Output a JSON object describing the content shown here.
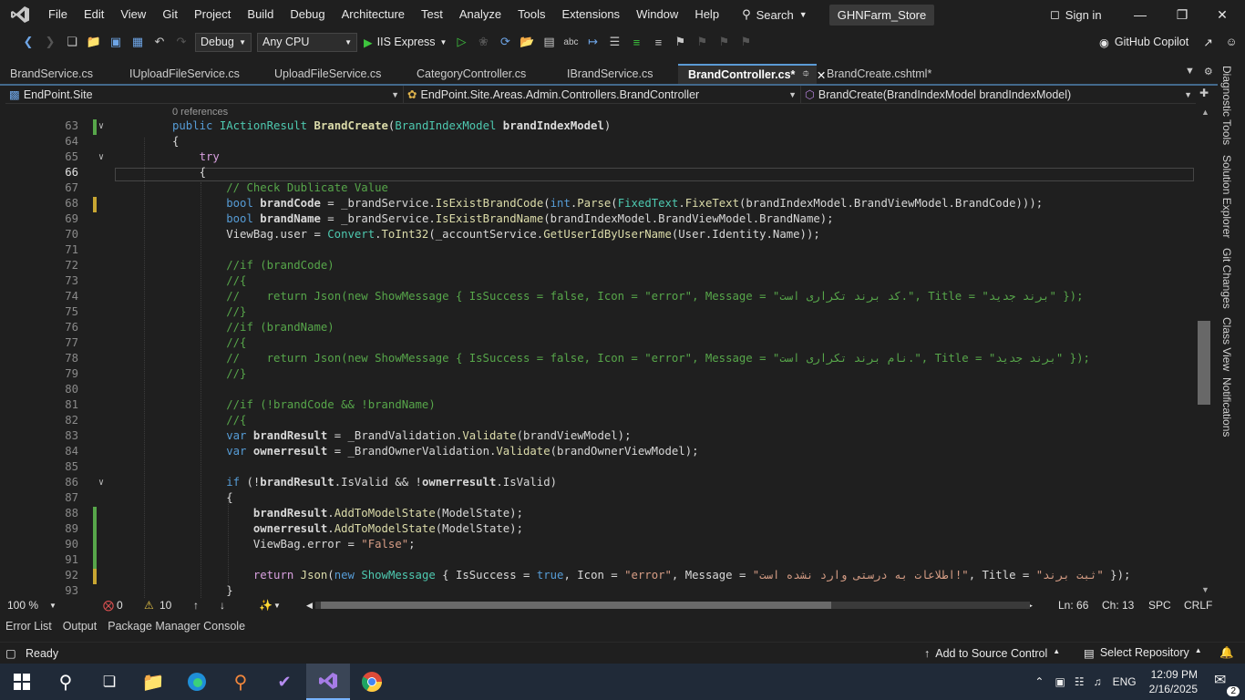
{
  "menu": {
    "items": [
      "File",
      "Edit",
      "View",
      "Git",
      "Project",
      "Build",
      "Debug",
      "Architecture",
      "Test",
      "Analyze",
      "Tools",
      "Extensions",
      "Window",
      "Help"
    ],
    "search_label": "Search",
    "solution_name": "GHNFarm_Store",
    "signin_label": "Sign in"
  },
  "toolbar": {
    "config": "Debug",
    "platform": "Any CPU",
    "run_target": "IIS Express",
    "copilot_label": "GitHub Copilot"
  },
  "tabs": [
    {
      "label": "BrandService.cs",
      "active": false
    },
    {
      "label": "IUploadFileService.cs",
      "active": false
    },
    {
      "label": "UploadFileService.cs",
      "active": false
    },
    {
      "label": "CategoryController.cs",
      "active": false
    },
    {
      "label": "IBrandService.cs",
      "active": false
    },
    {
      "label": "BrandController.cs*",
      "active": true
    },
    {
      "label": "BrandCreate.cshtml*",
      "active": false
    }
  ],
  "navbar": {
    "project": "EndPoint.Site",
    "class": "EndPoint.Site.Areas.Admin.Controllers.BrandController",
    "member": "BrandCreate(BrandIndexModel brandIndexModel)"
  },
  "editor": {
    "references_text": "0 references",
    "lines": [
      {
        "num": "63",
        "html": "<span class=\"kw\">public</span> <span class=\"type\">IActionResult</span> <span class=\"method bold\">BrandCreate</span>(<span class=\"type\">BrandIndexModel</span> <span class=\"ident bold\">brandIndexModel</span>)"
      },
      {
        "num": "64",
        "html": "{"
      },
      {
        "num": "65",
        "html": "    <span class=\"kw2\">try</span>"
      },
      {
        "num": "66",
        "html": "    {"
      },
      {
        "num": "67",
        "html": "        <span class=\"cm\">// Check Dublicate Value</span>"
      },
      {
        "num": "68",
        "html": "        <span class=\"kw\">bool</span> <span class=\"bold\">brandCode</span> = _brandService.<span class=\"method\">IsExistBrandCode</span>(<span class=\"kw\">int</span>.<span class=\"method\">Parse</span>(<span class=\"type\">FixedText</span>.<span class=\"method\">FixeText</span>(brandIndexModel.BrandViewModel.BrandCode)));"
      },
      {
        "num": "69",
        "html": "        <span class=\"kw\">bool</span> <span class=\"bold\">brandName</span> = _brandService.<span class=\"method\">IsExistBrandName</span>(brandIndexModel.BrandViewModel.BrandName);"
      },
      {
        "num": "70",
        "html": "        ViewBag.user = <span class=\"type\">Convert</span>.<span class=\"method\">ToInt32</span>(_accountService.<span class=\"method\">GetUserIdByUserName</span>(User.Identity.Name));"
      },
      {
        "num": "71",
        "html": ""
      },
      {
        "num": "72",
        "html": "        <span class=\"cm\">//if (brandCode)</span>"
      },
      {
        "num": "73",
        "html": "        <span class=\"cm\">//{</span>"
      },
      {
        "num": "74",
        "html": "        <span class=\"cm\">//    return Json(new ShowMessage { IsSuccess = false, Icon = \"error\", Message = \"کد برند تکراری است.\", Title = \"برند جدید\" });</span>"
      },
      {
        "num": "75",
        "html": "        <span class=\"cm\">//}</span>"
      },
      {
        "num": "76",
        "html": "        <span class=\"cm\">//if (brandName)</span>"
      },
      {
        "num": "77",
        "html": "        <span class=\"cm\">//{</span>"
      },
      {
        "num": "78",
        "html": "        <span class=\"cm\">//    return Json(new ShowMessage { IsSuccess = false, Icon = \"error\", Message = \"نام برند تکراری است.\", Title = \"برند جدید\" });</span>"
      },
      {
        "num": "79",
        "html": "        <span class=\"cm\">//}</span>"
      },
      {
        "num": "80",
        "html": ""
      },
      {
        "num": "81",
        "html": "        <span class=\"cm\">//if (!brandCode &amp;&amp; !brandName)</span>"
      },
      {
        "num": "82",
        "html": "        <span class=\"cm\">//{</span>"
      },
      {
        "num": "83",
        "html": "        <span class=\"kw\">var</span> <span class=\"bold\">brandResult</span> = _BrandValidation.<span class=\"method\">Validate</span>(brandViewModel);"
      },
      {
        "num": "84",
        "html": "        <span class=\"kw\">var</span> <span class=\"bold\">ownerresult</span> = _BrandOwnerValidation.<span class=\"method\">Validate</span>(brandOwnerViewModel);"
      },
      {
        "num": "85",
        "html": ""
      },
      {
        "num": "86",
        "html": "        <span class=\"kw\">if</span> (!<span class=\"bold\">brandResult</span>.IsValid &amp;&amp; !<span class=\"bold\">ownerresult</span>.IsValid)"
      },
      {
        "num": "87",
        "html": "        {"
      },
      {
        "num": "88",
        "html": "            <span class=\"bold\">brandResult</span>.<span class=\"method\">AddToModelState</span>(ModelState);"
      },
      {
        "num": "89",
        "html": "            <span class=\"bold\">ownerresult</span>.<span class=\"method\">AddToModelState</span>(ModelState);"
      },
      {
        "num": "90",
        "html": "            ViewBag.error = <span class=\"str\">\"False\"</span>;"
      },
      {
        "num": "91",
        "html": ""
      },
      {
        "num": "92",
        "html": "            <span class=\"kw2\">return</span> <span class=\"method\">Json</span>(<span class=\"kw\">new</span> <span class=\"type\">ShowMessage</span> { IsSuccess = <span class=\"kw\">true</span>, Icon = <span class=\"str\">\"error\"</span>, Message = <span class=\"str\">\"اطلاعات به درستی وارد نشده است!\"</span>, Title = <span class=\"str\">\"ثبت برند\"</span> });"
      },
      {
        "num": "93",
        "html": "        }"
      }
    ]
  },
  "editor_status": {
    "zoom": "100 %",
    "errors": "0",
    "warnings": "10",
    "line": "Ln: 66",
    "col": "Ch: 13",
    "spacing": "SPC",
    "eol": "CRLF"
  },
  "bottom_tabs": [
    "Error List",
    "Output",
    "Package Manager Console"
  ],
  "statusbar": {
    "ready": "Ready",
    "source_control": "Add to Source Control",
    "repository": "Select Repository"
  },
  "side_tabs": [
    "Diagnostic Tools",
    "Solution Explorer",
    "Git Changes",
    "Class View",
    "Notifications"
  ],
  "taskbar": {
    "language": "ENG",
    "time": "12:09 PM",
    "date": "2/16/2025",
    "notification_count": "2"
  }
}
